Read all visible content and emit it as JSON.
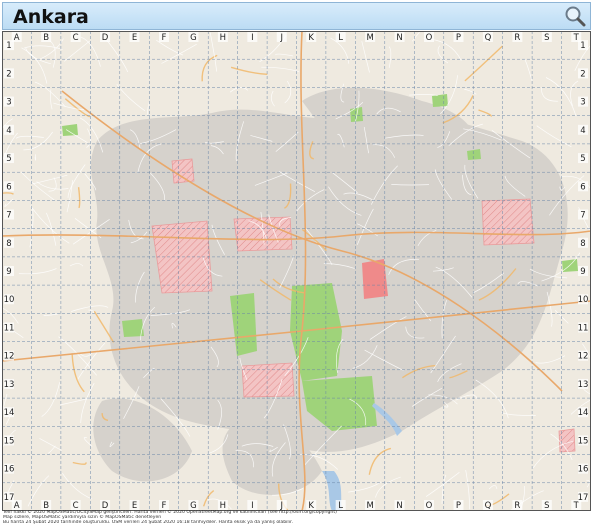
{
  "map": {
    "title": "Ankara",
    "columns": [
      "A",
      "B",
      "C",
      "D",
      "E",
      "F",
      "G",
      "H",
      "I",
      "J",
      "K",
      "L",
      "M",
      "N",
      "O",
      "P",
      "Q",
      "R",
      "S",
      "T"
    ],
    "rows": [
      "1",
      "2",
      "3",
      "4",
      "5",
      "6",
      "7",
      "8",
      "9",
      "10",
      "11",
      "12",
      "13",
      "14",
      "15",
      "16",
      "17"
    ],
    "colors": {
      "land": "#efeae0",
      "urban": "#d6d2cc",
      "park": "#9fd37a",
      "forest": "#7cc15d",
      "restricted": "#f3c4c4",
      "hatch": "#e99b9b",
      "water": "#a9c8e6",
      "grid": "#6a86a8",
      "title_bg": "#cfe6f8"
    },
    "icons": {
      "zoom": "magnifier-icon"
    }
  },
  "footer": {
    "line1": "Telif hakkı © 2020 MapOSMatic/OCitySMap geliştiricileri. Harita verileri © 2020 OpenStreetMap.org ve katılımcıları (see http://osm.org/copyright)",
    "line2": "Map sizlere, MapOSMatic yardımıyla sizin © MapOSMatic denetleyen",
    "line3": "Bu harita 24 Şubat 2020 tarihinde oluşturuldu. OSM verileri 24 Şubat 2020 16:18 tarihiydiler. Harita eksik ya da yanlış olabilir."
  }
}
